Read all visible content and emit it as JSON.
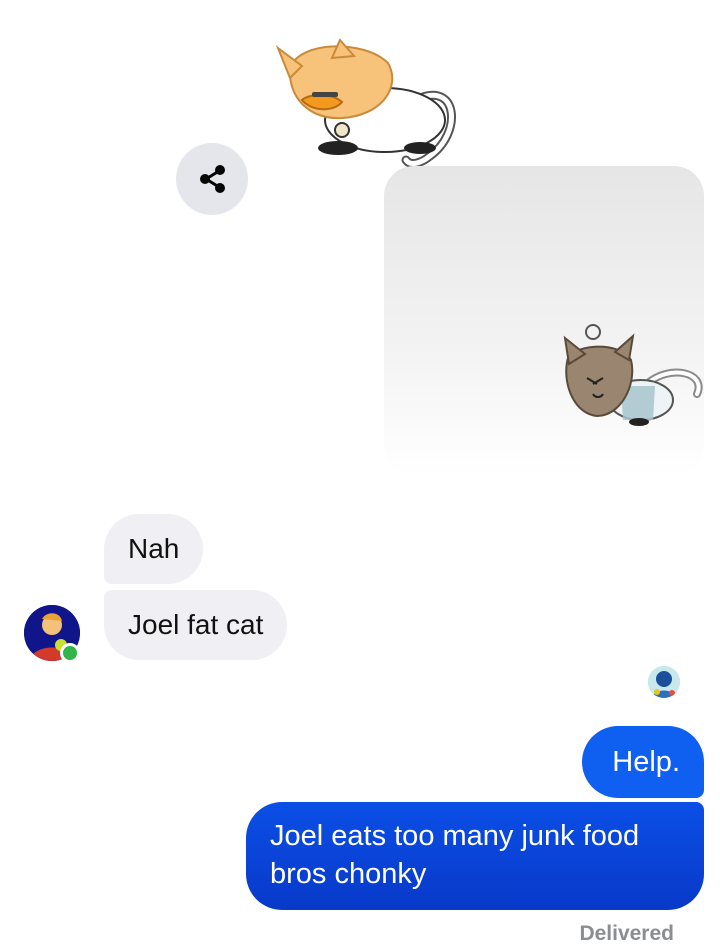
{
  "thread": {
    "messages": [
      {
        "direction": "sent",
        "kind": "sticker",
        "sticker": "orange-cat-sticker"
      },
      {
        "direction": "sent",
        "kind": "image",
        "image": "brown-cat-drawing"
      },
      {
        "direction": "received",
        "kind": "text",
        "text": "Nah"
      },
      {
        "direction": "received",
        "kind": "text",
        "text": "Joel fat cat"
      },
      {
        "direction": "sent",
        "kind": "text",
        "text": "Help."
      },
      {
        "direction": "sent",
        "kind": "text",
        "text": "Joel eats too many junk food bros chonky"
      }
    ],
    "status": "Delivered"
  },
  "icons": {
    "share": "share-icon",
    "contact_avatar": "contact-avatar",
    "online_indicator": "online-indicator",
    "seen_avatar": "seen-avatar"
  },
  "colors": {
    "sent_bubble": "#0f5ff0",
    "sent_bubble_dark": "#0839c9",
    "received_bubble": "#f0f0f4",
    "online": "#2fb646",
    "share_button_bg": "#e4e6eb"
  }
}
